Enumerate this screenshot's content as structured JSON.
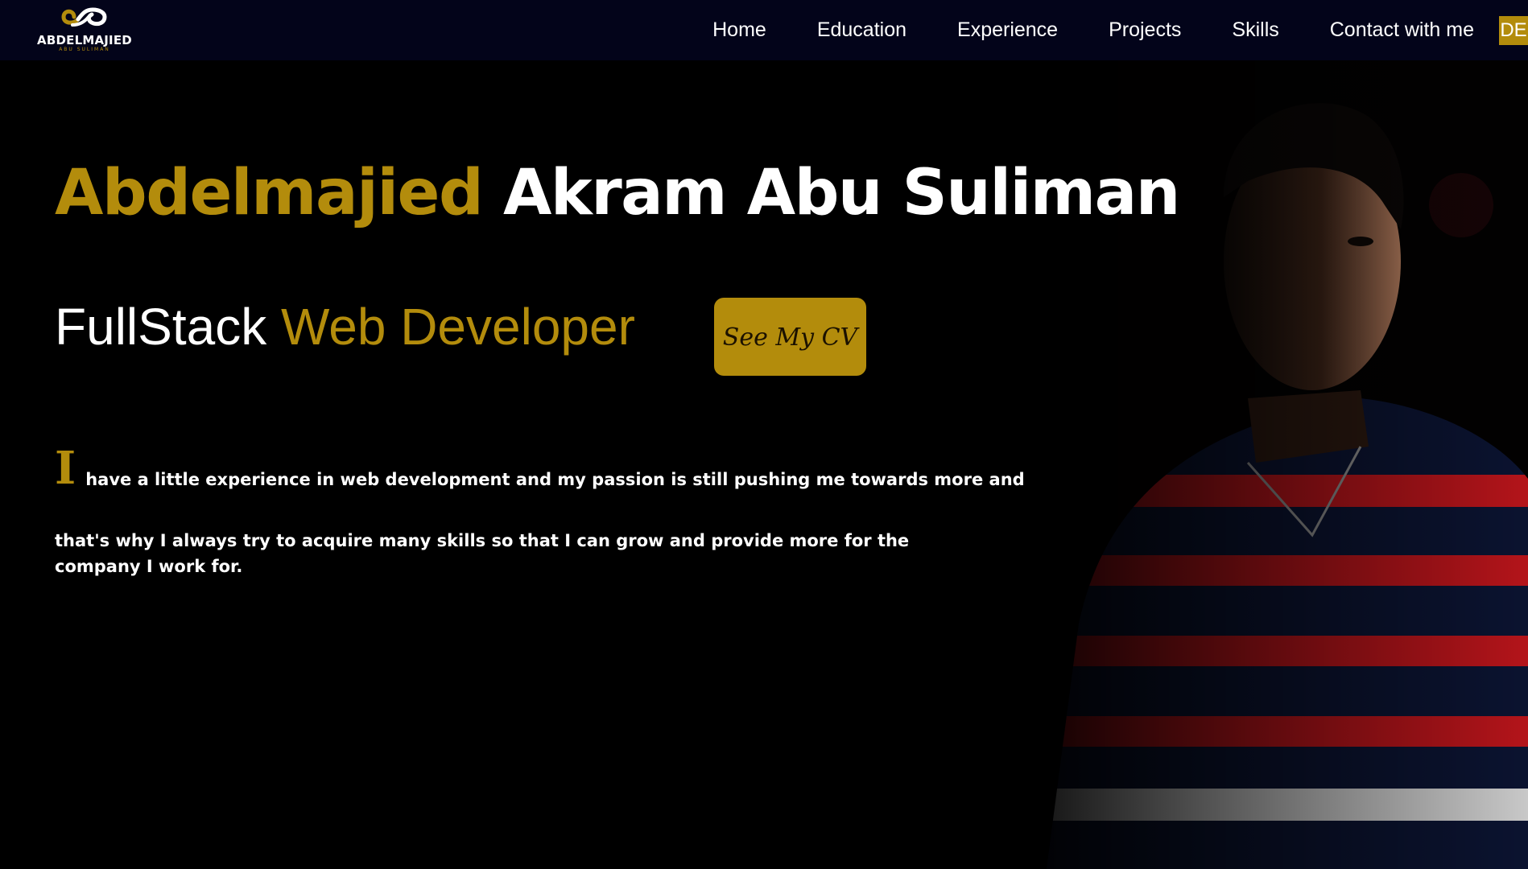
{
  "logo": {
    "name": "ABDELMAJIED",
    "subtitle": "ABU SULIMAN"
  },
  "nav": {
    "items": [
      "Home",
      "Education",
      "Experience",
      "Projects",
      "Skills",
      "Contact with me"
    ],
    "language_button": "DE"
  },
  "hero": {
    "first_name": "Abdelmajied",
    "last_name": "Akram Abu Suliman",
    "role_prefix": "FullStack",
    "role_main": "Web Developer",
    "cv_button": "See My CV"
  },
  "about": {
    "drop_cap": "I",
    "line1": "have a little experience in web development and my passion is still pushing me towards more and",
    "line2": "that's why I always try to acquire many skills so that I can grow and provide more for the company I work for."
  },
  "colors": {
    "accent": "#b38c0c",
    "navbar_bg": "#03041a",
    "page_bg": "#000000",
    "text": "#ffffff"
  },
  "icons": {
    "logo": "infinity-logo-icon"
  }
}
